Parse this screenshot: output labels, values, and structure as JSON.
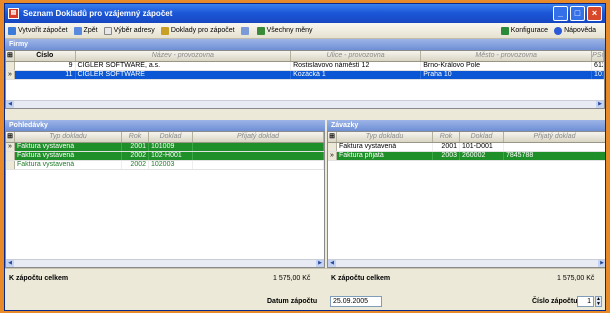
{
  "window": {
    "title": "Seznam Dokladů pro vzájemný zápočet",
    "app_icon": "document-list-icon"
  },
  "toolbar": {
    "create_offset": "Vytvořit zápočet",
    "back": "Zpět",
    "select_address": "Výběr adresy",
    "documents_for_offset": "Doklady pro zápočet",
    "all_currencies": "Všechny měny",
    "configuration": "Konfigurace",
    "help": "Nápověda"
  },
  "firms": {
    "label": "Firmy",
    "columns": [
      "Číslo",
      "Název - provozovna",
      "Ulice - provozovna",
      "Město - provozovna",
      "PSČ"
    ],
    "rows": [
      {
        "number": "9",
        "name": "CIGLER SOFTWARE, a.s.",
        "street": "Rostislavovo náměstí 12",
        "city": "Brno-Královo Pole",
        "zip": "6120"
      },
      {
        "number": "11",
        "name": "CIGLER SOFTWARE",
        "street": "Kozácká 1",
        "city": "Praha 10",
        "zip": "1010"
      }
    ]
  },
  "receivables": {
    "label": "Pohledávky",
    "columns": [
      "Typ dokladu",
      "Rok",
      "Doklad",
      "Přijatý doklad"
    ],
    "rows": [
      {
        "type": "Faktura vystavená",
        "year": "2001",
        "doc": "101009",
        "received": ""
      },
      {
        "type": "Faktura vystavená",
        "year": "2002",
        "doc": "102-H001",
        "received": ""
      },
      {
        "type": "Faktura vystavená",
        "year": "2002",
        "doc": "102003",
        "received": ""
      }
    ],
    "total_label": "K zápočtu celkem",
    "total_value": "1 575,00 Kč"
  },
  "liabilities": {
    "label": "Závazky",
    "columns": [
      "Typ dokladu",
      "Rok",
      "Doklad",
      "Přijatý doklad"
    ],
    "rows": [
      {
        "type": "Faktura vystavená",
        "year": "2001",
        "doc": "101-D001",
        "received": ""
      },
      {
        "type": "Faktura přijatá",
        "year": "2003",
        "doc": "260002",
        "received": "7845788"
      }
    ],
    "total_label": "K zápočtu celkem",
    "total_value": "1 575,00 Kč"
  },
  "footer": {
    "date_label": "Datum zápočtu",
    "date_value": "25.09.2005",
    "number_label": "Číslo zápočtu",
    "number_value": "1"
  },
  "colors": {
    "title_bar": "#1c58d8",
    "selected_row": "#0a56d4",
    "highlight_row": "#1f8f2a",
    "background": "#e88a2a"
  }
}
